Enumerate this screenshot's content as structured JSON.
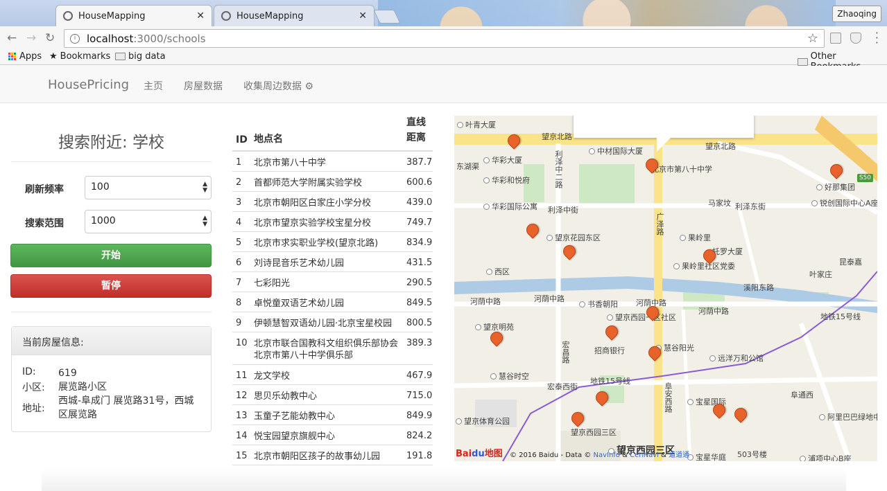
{
  "browser": {
    "tabs": [
      {
        "title": "HouseMapping",
        "active": true
      },
      {
        "title": "HouseMapping",
        "active": false
      }
    ],
    "profile": "Zhaoqing",
    "url_host": "localhost",
    "url_path": ":3000/schools",
    "bookmarks": [
      "Apps",
      "Bookmarks",
      "big data"
    ],
    "other_bookmarks": "Other Bookmarks"
  },
  "navbar": {
    "brand": "HousePricing",
    "links": [
      "主页",
      "房屋数据",
      "收集周边数据"
    ]
  },
  "search": {
    "title": "搜索附近: 学校",
    "refresh_label": "刷新频率",
    "refresh_value": "100",
    "range_label": "搜索范围",
    "range_value": "1000",
    "start_button": "开始",
    "pause_button": "暂停"
  },
  "current_house": {
    "heading": "当前房屋信息:",
    "id_label": "ID:",
    "id_value": "619",
    "community_label": "小区:",
    "community_value": "展览路小区",
    "address_label": "地址:",
    "address_value": "西城-阜成门 展览路31号，西城区展览路"
  },
  "table": {
    "headers": [
      "ID",
      "地点名",
      "直线",
      "距离"
    ],
    "rows": [
      {
        "id": "1",
        "name": "北京市第八十中学",
        "dist": "387.7"
      },
      {
        "id": "2",
        "name": "首都师范大学附属实验学校",
        "dist": "600.6"
      },
      {
        "id": "3",
        "name": "北京市朝阳区白家庄小学分校",
        "dist": "439.0"
      },
      {
        "id": "4",
        "name": "北京市望京实验学校宝星分校",
        "dist": "749.7"
      },
      {
        "id": "5",
        "name": "北京市求实职业学校(望京北路)",
        "dist": "834.9"
      },
      {
        "id": "6",
        "name": "刘诗昆音乐艺术幼儿园",
        "dist": "431.5"
      },
      {
        "id": "7",
        "name": "七彩阳光",
        "dist": "290.5"
      },
      {
        "id": "8",
        "name": "卓悦童双语艺术幼儿园",
        "dist": "849.5"
      },
      {
        "id": "9",
        "name": "伊顿慧智双语幼儿园·北京宝星校园",
        "dist": "800.5"
      },
      {
        "id": "10",
        "name": "北京市联合国教科文组织俱乐部协会北京市第八十中学俱乐部",
        "dist": "389.3"
      },
      {
        "id": "11",
        "name": "龙文学校",
        "dist": "467.9"
      },
      {
        "id": "12",
        "name": "思贝乐幼教中心",
        "dist": "715.0"
      },
      {
        "id": "13",
        "name": "玉童子艺能幼教中心",
        "dist": "849.9"
      },
      {
        "id": "14",
        "name": "悦宝园望京旗舰中心",
        "dist": "824.2"
      },
      {
        "id": "15",
        "name": "北京市朝阳区孩子的故事幼儿园",
        "dist": "191.8"
      }
    ]
  },
  "map": {
    "labels": [
      "叶青大厦",
      "望京北路",
      "中材国际大厦",
      "北京市第八十中学",
      "望京北路",
      "S50",
      "东湖渠",
      "华彩大厦",
      "利泽中二路",
      "华彩和悦府",
      "好那集团",
      "华彩国际公寓",
      "利泽中街",
      "马家坟",
      "利泽东街",
      "锐创国际中心A座",
      "广泽路",
      "望京花园东区",
      "果岭里",
      "西区",
      "托罗大厦",
      "果岭里社区党委",
      "昆泰嘉",
      "叶家庄",
      "溪阳东路",
      "河荫中路",
      "河荫中路",
      "书香朝阳",
      "河荫中路",
      "河荫中路",
      "望京明苑",
      "望京西园一区社区",
      "招商银行",
      "慧谷阳光",
      "地铁15号线",
      "宏昌路",
      "远洋万和公馆",
      "慧谷时空",
      "宏泰西街",
      "地铁15号线",
      "阜安西路",
      "宝星国际",
      "阜通西",
      "望京体育公园",
      "阿里巴巴绿地中心",
      "望京西园三区",
      "望京西园三区",
      "宝星华庭",
      "503号楼",
      "浦项中心B座"
    ],
    "copyright": "© 2016 Baidu - Data ©",
    "copyright_links": [
      "NavInfo",
      "&",
      "CenNavi",
      "&",
      "道道通"
    ]
  }
}
